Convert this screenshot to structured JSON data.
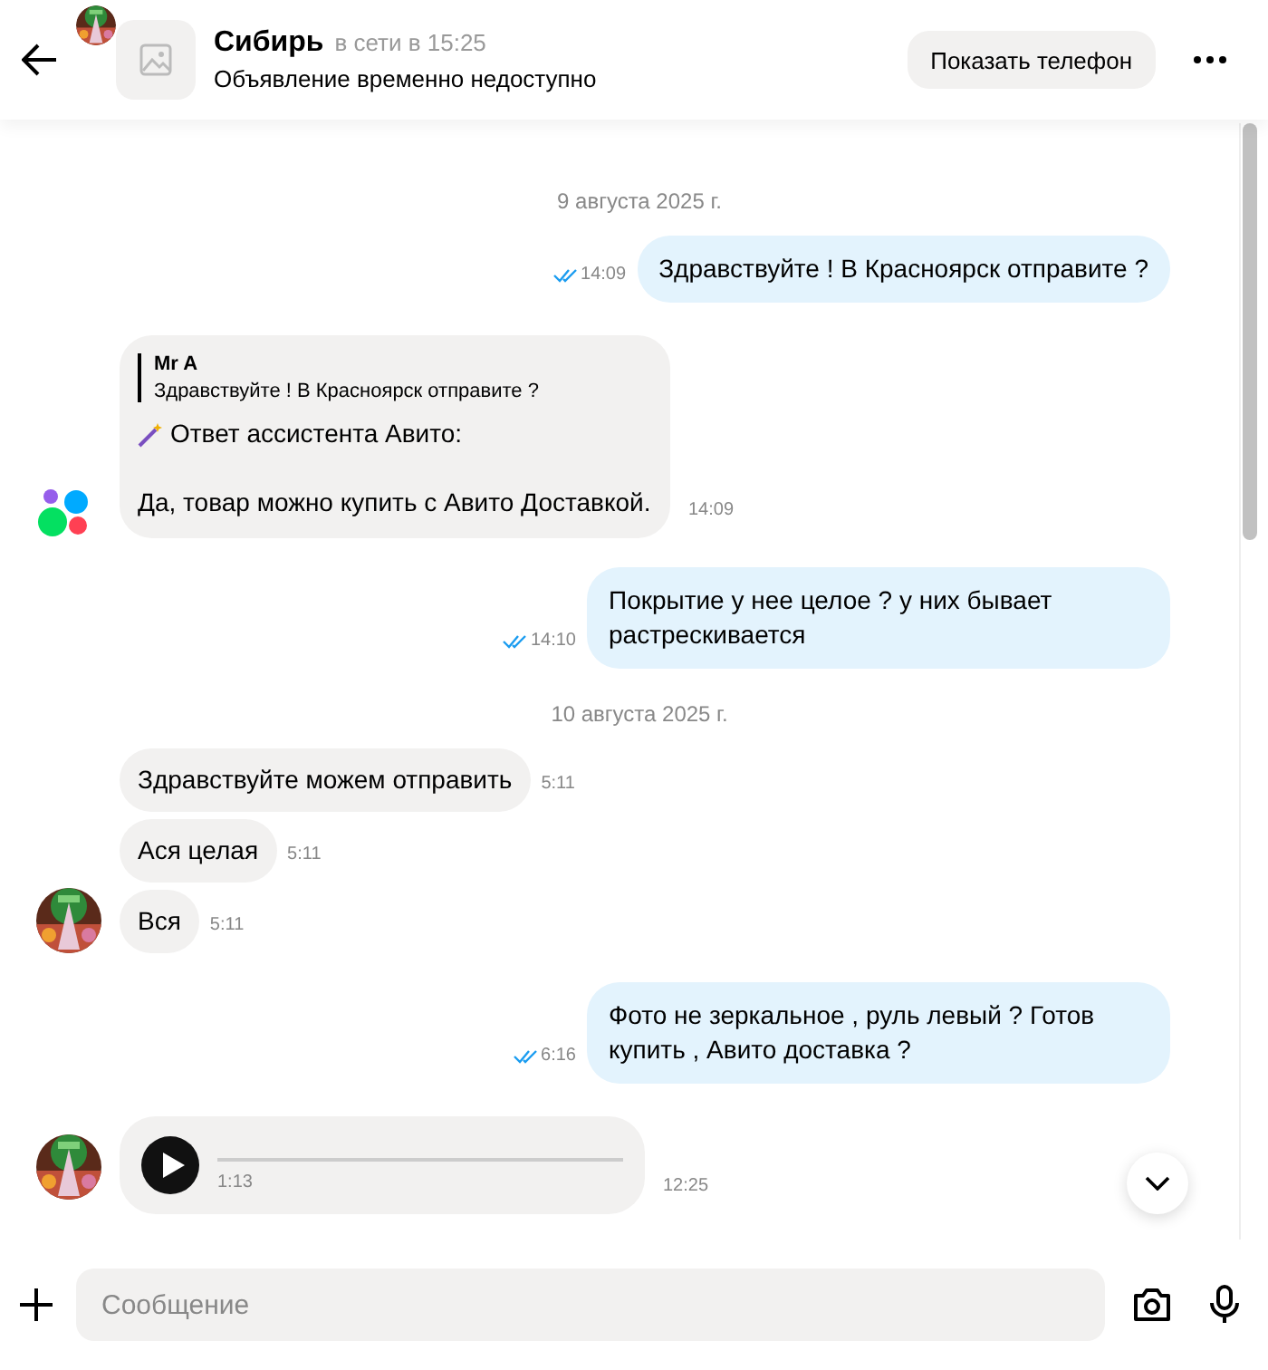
{
  "header": {
    "name": "Сибирь",
    "status": "в сети в 15:25",
    "listing": "Объявление временно недоступно",
    "phone_button": "Показать телефон"
  },
  "messages": [
    {
      "kind": "date",
      "text": "9 августа 2025 г."
    },
    {
      "kind": "outgoing",
      "text": "Здравствуйте ! В Красноярск отправите ?",
      "time": "14:09",
      "read": true
    },
    {
      "kind": "assistant",
      "quote_author": "Mr A",
      "quote_text": "Здравствуйте ! В Красноярск отправите ?",
      "title": "Ответ ассистента Авито:",
      "text": "Да, товар можно купить с Авито Доставкой.",
      "time": "14:09"
    },
    {
      "kind": "outgoing",
      "text": "Покрытие у нее целое ? у них бывает растрескивается",
      "time": "14:10",
      "read": true
    },
    {
      "kind": "date",
      "text": "10 августа 2025 г."
    },
    {
      "kind": "incoming",
      "messages": [
        {
          "text": "Здравствуйте можем отправить",
          "time": "5:11"
        },
        {
          "text": "Ася целая",
          "time": "5:11"
        },
        {
          "text": "Вся",
          "time": "5:11"
        }
      ]
    },
    {
      "kind": "outgoing",
      "text": "Фото не зеркальное , руль левый ? Готов купить , Авито доставка ?",
      "time": "6:16",
      "read": true
    },
    {
      "kind": "audio",
      "duration": "1:13",
      "time": "12:25"
    }
  ],
  "composer": {
    "placeholder": "Сообщение"
  }
}
